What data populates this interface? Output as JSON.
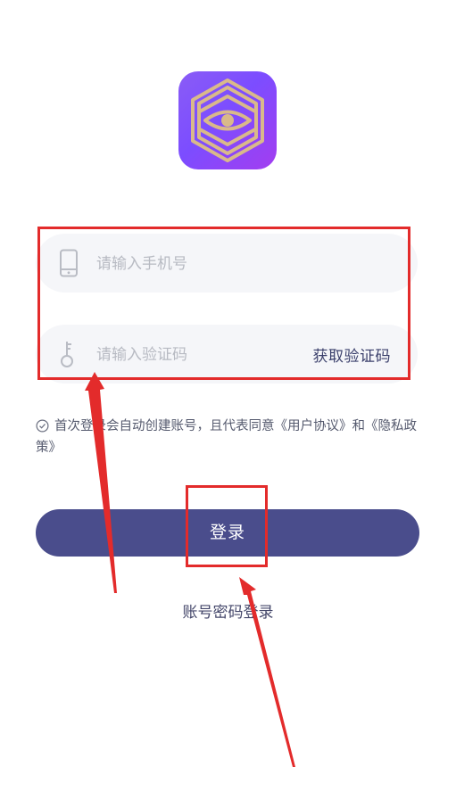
{
  "app": {
    "logo_icon": "hexagon-eye-logo",
    "accent": "#4a4d8c",
    "logo_gold": "#d9b98a"
  },
  "form": {
    "phone": {
      "icon": "phone-icon",
      "placeholder": "请输入手机号",
      "value": ""
    },
    "code": {
      "icon": "key-icon",
      "placeholder": "请输入验证码",
      "value": "",
      "get_code_label": "获取验证码"
    }
  },
  "agreement": {
    "check_icon": "check-circle-icon",
    "text_before": "首次登录会自动创建账号，且代表同意",
    "user_agreement": "《用户协议》",
    "and": "和",
    "privacy_policy": "《隐私政策》"
  },
  "actions": {
    "login_label": "登录",
    "password_login_label": "账号密码登录"
  },
  "annotations": {
    "color": "#e32b2b"
  }
}
